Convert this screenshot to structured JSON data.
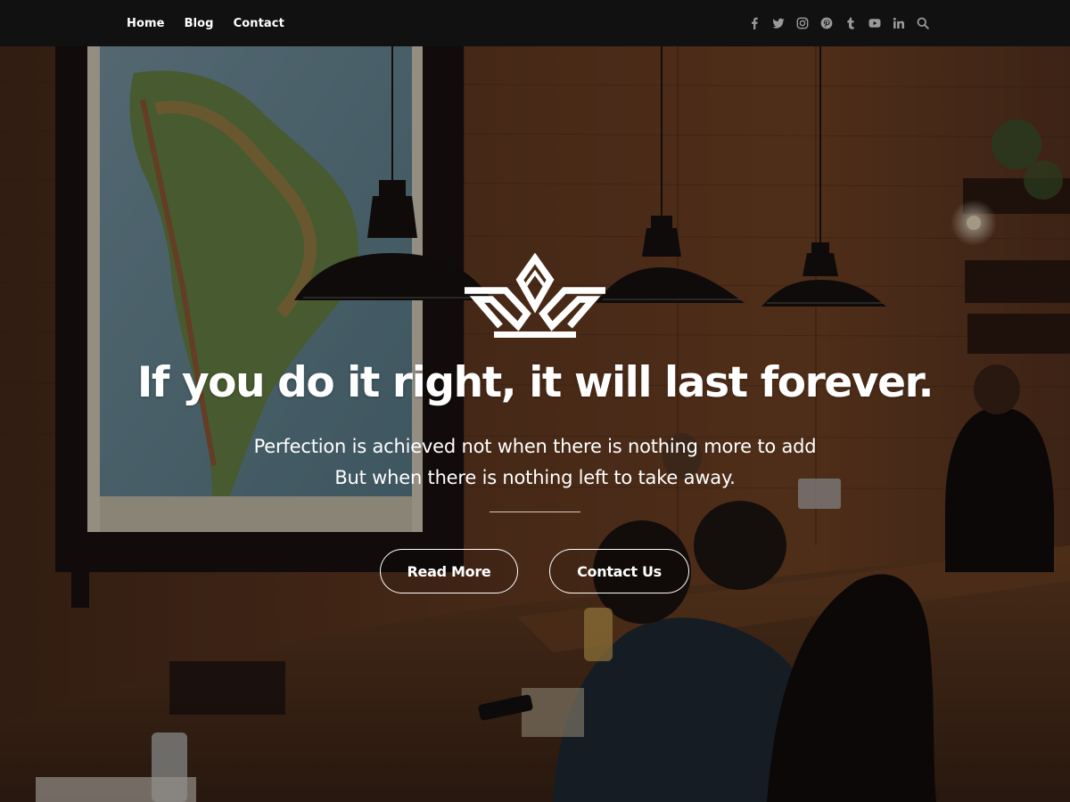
{
  "nav": {
    "items": [
      {
        "label": "Home"
      },
      {
        "label": "Blog"
      },
      {
        "label": "Contact"
      }
    ]
  },
  "social": {
    "icons": [
      "facebook-icon",
      "twitter-icon",
      "instagram-icon",
      "pinterest-icon",
      "tumblr-icon",
      "youtube-icon",
      "linkedin-icon",
      "search-icon"
    ],
    "icon_color": "#9a9a9a"
  },
  "hero": {
    "title": "If you do it right, it will last forever.",
    "subtitle_line1": "Perfection is achieved not when there is nothing more to add",
    "subtitle_line2": "But when there is nothing left to take away.",
    "buttons": {
      "read_more": "Read More",
      "contact_us": "Contact Us"
    }
  },
  "colors": {
    "topbar_bg": "#111111",
    "text": "#ffffff",
    "wood_dark": "#3a2416"
  }
}
